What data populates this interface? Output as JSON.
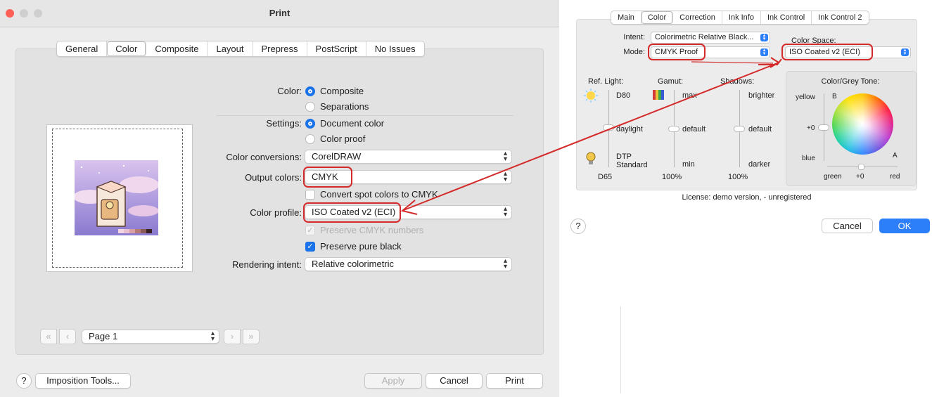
{
  "print_dialog": {
    "title": "Print",
    "tabs": [
      "General",
      "Color",
      "Composite",
      "Layout",
      "Prepress",
      "PostScript",
      "No Issues"
    ],
    "selected_tab": "Color",
    "color": {
      "label": "Color:",
      "options": [
        "Composite",
        "Separations"
      ],
      "selected": "Composite"
    },
    "settings": {
      "label": "Settings:",
      "options": [
        "Document color",
        "Color proof"
      ],
      "selected": "Document color"
    },
    "color_conversions": {
      "label": "Color conversions:",
      "value": "CorelDRAW"
    },
    "output_colors": {
      "label": "Output colors:",
      "value": "CMYK"
    },
    "convert_spot": {
      "label": "Convert spot colors to CMYK",
      "checked": false
    },
    "color_profile": {
      "label": "Color profile:",
      "value": "ISO Coated v2 (ECI)"
    },
    "preserve_cmyk": {
      "label": "Preserve CMYK numbers",
      "checked": true,
      "disabled": true
    },
    "preserve_black": {
      "label": "Preserve pure black",
      "checked": true
    },
    "rendering_intent": {
      "label": "Rendering intent:",
      "value": "Relative colorimetric"
    },
    "page_nav": {
      "page": "Page 1"
    },
    "buttons": {
      "help": "?",
      "imposition": "Imposition Tools...",
      "apply": "Apply",
      "cancel": "Cancel",
      "print": "Print"
    }
  },
  "ink_dialog": {
    "tabs": [
      "Main",
      "Color",
      "Correction",
      "Ink Info",
      "Ink Control",
      "Ink Control 2"
    ],
    "selected_tab": "Color",
    "intent": {
      "label": "Intent:",
      "value": "Colorimetric Relative Black..."
    },
    "mode": {
      "label": "Mode:",
      "value": "CMYK Proof"
    },
    "color_space": {
      "label": "Color Space:",
      "value": "ISO Coated v2 (ECI)"
    },
    "ref_light": {
      "title": "Ref. Light:",
      "top": "D80",
      "mid": "daylight",
      "bottom": "DTP Standard",
      "value": "D65"
    },
    "gamut": {
      "title": "Gamut:",
      "top": "max",
      "mid": "default",
      "bottom": "min",
      "value": "100%"
    },
    "shadows": {
      "title": "Shadows:",
      "top": "brighter",
      "mid": "default",
      "bottom": "darker",
      "value": "100%"
    },
    "color_tone": {
      "title": "Color/Grey Tone:",
      "yellow": "yellow",
      "b": "B",
      "plus0_v": "+0",
      "blue": "blue",
      "a": "A",
      "green": "green",
      "plus0_h": "+0",
      "red": "red"
    },
    "license": "License: demo version,  - unregistered",
    "buttons": {
      "help": "?",
      "cancel": "Cancel",
      "ok": "OK"
    }
  },
  "colors": {
    "accent": "#1a73e8",
    "annotation": "#d42a2a",
    "ok_button": "#2d7ff9"
  }
}
